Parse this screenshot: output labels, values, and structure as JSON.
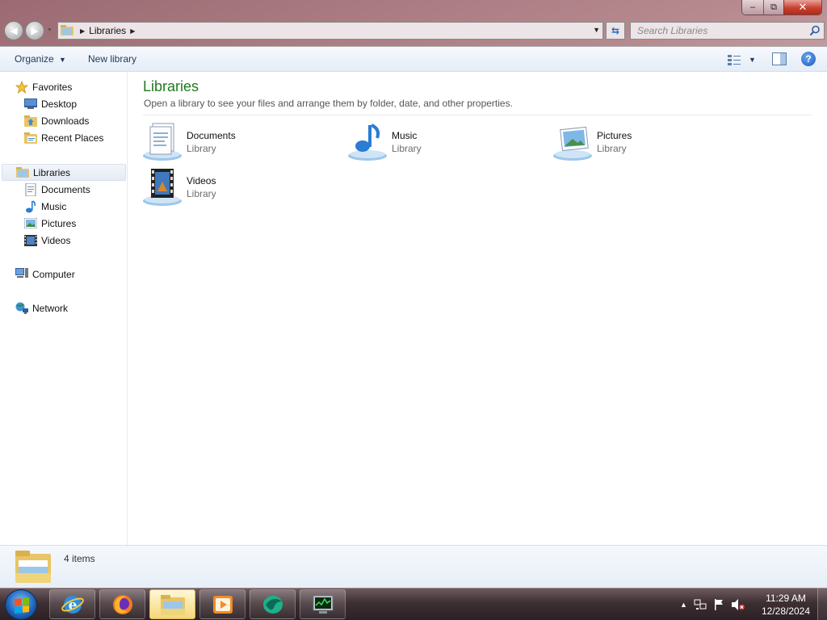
{
  "address": {
    "path": [
      "Libraries"
    ]
  },
  "search": {
    "placeholder": "Search Libraries"
  },
  "toolbar": {
    "organize_label": "Organize",
    "new_library_label": "New library"
  },
  "nav_pane": {
    "favorites": {
      "label": "Favorites",
      "items": [
        {
          "label": "Desktop",
          "icon": "desktop-icon"
        },
        {
          "label": "Downloads",
          "icon": "downloads-icon"
        },
        {
          "label": "Recent Places",
          "icon": "recent-places-icon"
        }
      ]
    },
    "libraries": {
      "label": "Libraries",
      "selected": true,
      "items": [
        {
          "label": "Documents",
          "icon": "documents-icon"
        },
        {
          "label": "Music",
          "icon": "music-icon"
        },
        {
          "label": "Pictures",
          "icon": "pictures-icon"
        },
        {
          "label": "Videos",
          "icon": "videos-icon"
        }
      ]
    },
    "computer": {
      "label": "Computer"
    },
    "network": {
      "label": "Network"
    }
  },
  "content": {
    "heading": "Libraries",
    "subheading": "Open a library to see your files and arrange them by folder, date, and other properties.",
    "libraries": [
      {
        "name": "Documents",
        "type": "Library",
        "icon": "documents-library-icon"
      },
      {
        "name": "Music",
        "type": "Library",
        "icon": "music-library-icon"
      },
      {
        "name": "Pictures",
        "type": "Library",
        "icon": "pictures-library-icon"
      },
      {
        "name": "Videos",
        "type": "Library",
        "icon": "videos-library-icon"
      }
    ]
  },
  "details": {
    "item_count": "4 items"
  },
  "taskbar": {
    "apps": [
      "internet-explorer-icon",
      "firefox-icon",
      "windows-explorer-icon",
      "media-player-icon",
      "app-icon",
      "task-manager-icon"
    ],
    "active_app": "windows-explorer-icon",
    "clock": {
      "time": "11:29 AM",
      "date": "12/28/2024"
    }
  },
  "colors": {
    "heading_green": "#1e7a1e",
    "toolbar_text": "#1e395b",
    "close_red": "#c7402f"
  }
}
